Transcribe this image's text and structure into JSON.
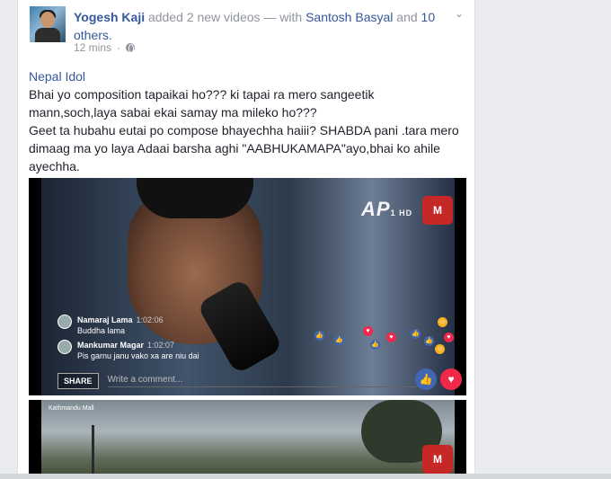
{
  "post": {
    "author": "Yogesh Kaji",
    "action_text": "added 2 new videos — with",
    "tagged": "Santosh Basyal",
    "and_text": "and",
    "others": "10 others.",
    "time": "12 mins",
    "privacy_icon": "globe-icon",
    "menu_icon": "chevron-down-icon",
    "page_link": "Nepal Idol",
    "text_lines": [
      "Bhai yo composition tapaikai ho??? ki tapai ra mero sangeetik mann,soch,laya sabai ekai samay ma mileko ho???",
      "Geet ta hubahu eutai po compose bhayechha haiii? SHABDA pani .tara mero dimaag ma yo laya Adaai barsha aghi \"AABHUKAMAPA\"ayo,bhai ko ahile ayechha."
    ]
  },
  "video1": {
    "channel_logo": "AP",
    "channel_logo_sub": "1 HD",
    "corner_logo": "M",
    "comments": [
      {
        "name": "Namaraj Lama",
        "time": "1:02:06",
        "text": "Buddha lama"
      },
      {
        "name": "Mankumar Magar",
        "time": "1:02:07",
        "text": "Pis garnu janu vako xa are niu dai"
      }
    ],
    "share_label": "SHARE",
    "comment_placeholder": "Write a comment..."
  },
  "video2": {
    "caption": "Kathmandu Mall",
    "corner_logo": "M"
  },
  "colors": {
    "link": "#365899",
    "meta": "#90949c",
    "like": "#4267b2",
    "love": "#f0284a"
  }
}
